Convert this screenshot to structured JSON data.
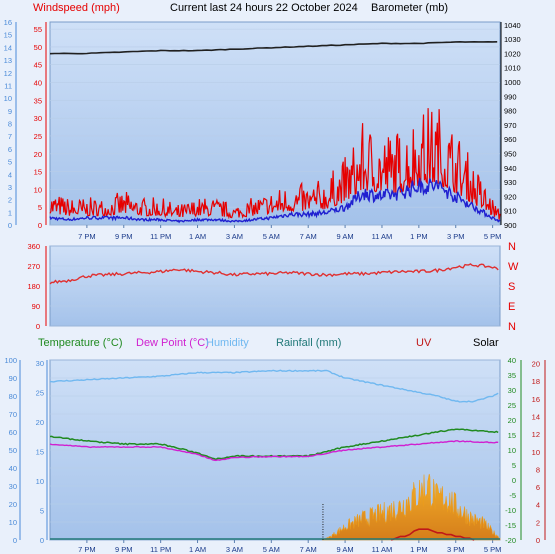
{
  "header": {
    "title": "Current last 24 hours 22 October 2024",
    "left_label": "Windspeed (mph)",
    "right_label": "Barometer (mb)"
  },
  "bottom_header": {
    "temperature": "Temperature (°C)",
    "dew_point": "Dew Point (°C)",
    "humidity": "Humidity",
    "rainfall": "Rainfall (mm)",
    "uv": "UV",
    "solar": "Solar"
  },
  "colors": {
    "windspeed": "#e60000",
    "windspeed_avg": "#2020d0",
    "barometer": "#202020",
    "direction": "#e03030",
    "temperature": "#208a20",
    "dew_point": "#d020d0",
    "humidity": "#70b8f0",
    "rainfall": "#207878",
    "uv": "#c01818",
    "solar": "#f09a10",
    "plot_top": "#c8dcf6",
    "plot_bottom": "#a6c4ea"
  },
  "chart_data": [
    {
      "type": "line",
      "name": "wind-barometer",
      "x_ticks": [
        "7 PM",
        "9 PM",
        "11 PM",
        "1 AM",
        "3 AM",
        "5 AM",
        "7 AM",
        "9 AM",
        "11 AM",
        "1 PM",
        "3 PM",
        "5 PM"
      ],
      "y_left_ticks": [
        "0",
        "5",
        "10",
        "15",
        "20",
        "25",
        "30",
        "35",
        "40",
        "45",
        "50",
        "55"
      ],
      "y_far_left_ticks": [
        "0",
        "1",
        "2",
        "3",
        "4",
        "5",
        "6",
        "7",
        "8",
        "9",
        "10",
        "11",
        "12",
        "13",
        "14",
        "15",
        "16"
      ],
      "y_right_ticks": [
        "900",
        "910",
        "920",
        "930",
        "940",
        "950",
        "960",
        "970",
        "980",
        "990",
        "1000",
        "1010",
        "1020",
        "1030",
        "1040"
      ],
      "ylim_left": [
        0,
        57
      ],
      "ylim_right": [
        900,
        1042
      ],
      "x_range_hours": [
        17.0,
        41.4
      ],
      "series": [
        {
          "name": "Windspeed (mph)",
          "axis": "left",
          "x": [
            17,
            18,
            19,
            20,
            21,
            22,
            23,
            24,
            25,
            26,
            27,
            28,
            29,
            30,
            31,
            32,
            33,
            34,
            35,
            36,
            37,
            38,
            39,
            40,
            41,
            41.4
          ],
          "values": [
            5,
            4,
            4,
            4,
            5,
            4,
            4,
            3,
            4,
            4,
            3,
            4,
            5,
            6,
            6,
            7,
            10,
            15,
            14,
            14,
            17,
            18,
            14,
            9,
            4,
            2
          ]
        },
        {
          "name": "Wind average",
          "axis": "left",
          "x": [
            17,
            18,
            19,
            20,
            21,
            22,
            23,
            24,
            25,
            26,
            27,
            28,
            29,
            30,
            31,
            32,
            33,
            34,
            35,
            36,
            37,
            38,
            39,
            40,
            41,
            41.4
          ],
          "values": [
            2,
            1.5,
            2,
            2,
            2,
            1.5,
            1.5,
            1,
            1.5,
            1.5,
            1,
            1.5,
            2,
            3,
            3,
            3.5,
            5,
            9,
            8,
            9,
            11,
            11,
            8,
            5,
            2,
            1
          ]
        },
        {
          "name": "Barometer (mb)",
          "axis": "right",
          "x": [
            17,
            19,
            21,
            23,
            25,
            27,
            29,
            31,
            33,
            35,
            37,
            39,
            41,
            41.4
          ],
          "values": [
            1020,
            1020,
            1021,
            1022,
            1022,
            1023,
            1024,
            1025,
            1026,
            1027,
            1027,
            1028,
            1028,
            1028
          ]
        }
      ]
    },
    {
      "type": "line",
      "name": "wind-direction",
      "y_left_ticks": [
        "0",
        "90",
        "180",
        "270",
        "360"
      ],
      "y_right_ticks": [
        "N",
        "E",
        "S",
        "W",
        "N"
      ],
      "ylim": [
        0,
        360
      ],
      "series": [
        {
          "name": "Wind direction",
          "x": [
            17,
            18,
            19,
            20,
            21,
            22,
            23,
            24,
            25,
            26,
            27,
            28,
            29,
            30,
            31,
            32,
            33,
            34,
            35,
            36,
            37,
            38,
            39,
            40,
            41,
            41.4
          ],
          "values": [
            195,
            205,
            225,
            230,
            235,
            240,
            245,
            255,
            245,
            240,
            230,
            235,
            235,
            240,
            235,
            230,
            235,
            235,
            240,
            245,
            245,
            250,
            265,
            275,
            265,
            250
          ]
        }
      ]
    },
    {
      "type": "line",
      "name": "temperature-humidity-rain-solar",
      "y_left1_ticks": [
        "0",
        "5",
        "10",
        "15",
        "20",
        "25",
        "30"
      ],
      "y_left2_ticks": [
        "0",
        "10",
        "20",
        "30",
        "40",
        "50",
        "60",
        "70",
        "80",
        "90",
        "100"
      ],
      "y_right1_ticks": [
        "-20",
        "-15",
        "-10",
        "-5",
        "0",
        "5",
        "10",
        "15",
        "20",
        "25",
        "30",
        "35",
        "40"
      ],
      "y_right2_ticks": [
        "0",
        "2",
        "4",
        "6",
        "8",
        "10",
        "12",
        "14",
        "16",
        "18",
        "20"
      ],
      "ylim_temp": [
        -20,
        40
      ],
      "ylim_humidity": [
        0,
        100
      ],
      "series": [
        {
          "name": "Temperature (°C)",
          "axis": "temp",
          "x": [
            17,
            19,
            21,
            23,
            25,
            26,
            27,
            29,
            31,
            33,
            35,
            37,
            39,
            41,
            41.4
          ],
          "values": [
            14.5,
            13,
            12,
            12,
            9,
            7,
            8,
            8,
            8,
            11,
            13,
            15,
            17,
            16,
            16
          ]
        },
        {
          "name": "Dew Point (°C)",
          "axis": "temp",
          "x": [
            17,
            19,
            21,
            23,
            25,
            26,
            27,
            29,
            31,
            33,
            35,
            37,
            39,
            41,
            41.4
          ],
          "values": [
            12,
            11,
            11,
            11,
            8.5,
            6.5,
            7.5,
            7.8,
            7.8,
            10,
            11,
            12,
            13,
            12.5,
            12.5
          ]
        },
        {
          "name": "Humidity",
          "axis": "humidity",
          "x": [
            17,
            19,
            21,
            23,
            25,
            27,
            29,
            31,
            32,
            33,
            35,
            37,
            38,
            39,
            40,
            41,
            41.4
          ],
          "values": [
            88,
            89,
            90,
            91,
            93,
            93,
            94,
            94,
            94,
            90,
            86,
            82,
            80,
            77,
            77,
            80,
            82
          ]
        },
        {
          "name": "Solar",
          "axis": "humidity",
          "x": [
            31.8,
            32.2,
            33,
            34,
            35,
            36,
            37,
            37.5,
            38,
            38.5,
            39,
            39.5,
            40,
            40.5,
            41,
            41.4
          ],
          "values": [
            0,
            2,
            8,
            13,
            16,
            20,
            28,
            33,
            24,
            26,
            20,
            16,
            12,
            10,
            5,
            1
          ]
        },
        {
          "name": "UV",
          "axis": "humidity",
          "x": [
            35.5,
            36.5,
            37,
            37.5,
            38,
            39,
            40
          ],
          "values": [
            0,
            3,
            6,
            6,
            4,
            2,
            0
          ]
        },
        {
          "name": "Rainfall (mm)",
          "axis": "humidity",
          "x": [
            17,
            41.4
          ],
          "values": [
            0,
            0
          ]
        }
      ]
    }
  ]
}
